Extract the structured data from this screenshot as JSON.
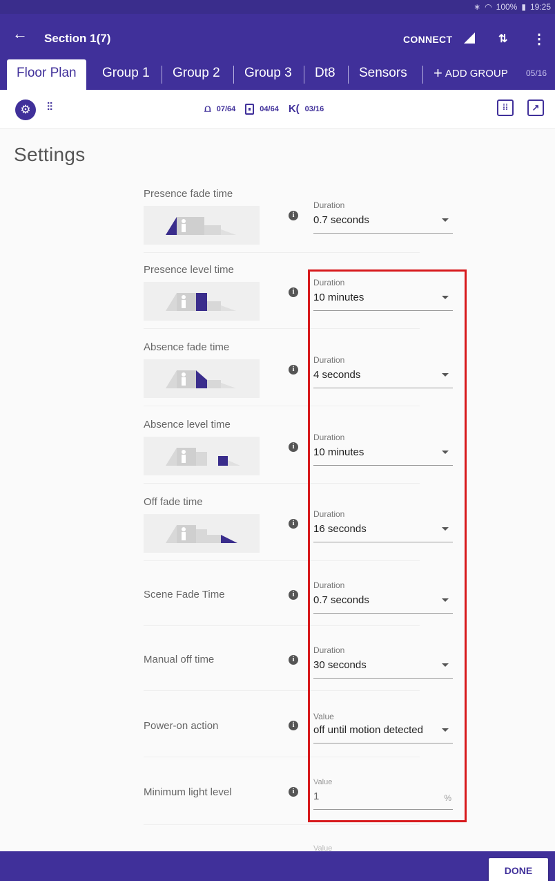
{
  "status_bar": {
    "bluetooth_icon": "bluetooth-icon",
    "wifi_icon": "wifi-icon",
    "battery": "100%",
    "time": "19:25"
  },
  "app_bar": {
    "title": "Section 1(7)",
    "connect_label": "CONNECT",
    "accent": "#40309a"
  },
  "tabs": {
    "items": [
      {
        "label": "Floor Plan"
      },
      {
        "label": "Group 1"
      },
      {
        "label": "Group 2"
      },
      {
        "label": "Group 3"
      },
      {
        "label": "Dt8"
      },
      {
        "label": "Sensors"
      }
    ],
    "add_label": "ADD GROUP",
    "count": "05/16"
  },
  "toolbar": {
    "lamps": "07/64",
    "switches": "04/64",
    "sensors": "03/16"
  },
  "settings": {
    "title": "Settings",
    "rows": [
      {
        "label": "Presence fade time",
        "field_label": "Duration",
        "value": "0.7 seconds"
      },
      {
        "label": "Presence level time",
        "field_label": "Duration",
        "value": "10 minutes"
      },
      {
        "label": "Absence fade time",
        "field_label": "Duration",
        "value": "4 seconds"
      },
      {
        "label": "Absence level time",
        "field_label": "Duration",
        "value": "10 minutes"
      },
      {
        "label": "Off fade time",
        "field_label": "Duration",
        "value": "16 seconds"
      },
      {
        "label": "Scene Fade Time",
        "field_label": "Duration",
        "value": "0.7 seconds"
      },
      {
        "label": "Manual off time",
        "field_label": "Duration",
        "value": "30 seconds"
      },
      {
        "label": "Power-on action",
        "field_label": "Value",
        "value": "off until motion detected"
      },
      {
        "label": "Minimum light level",
        "field_label": "Value",
        "value": "1",
        "unit": "%"
      }
    ],
    "partial_field_label": "Value"
  },
  "footer": {
    "done_label": "DONE"
  }
}
